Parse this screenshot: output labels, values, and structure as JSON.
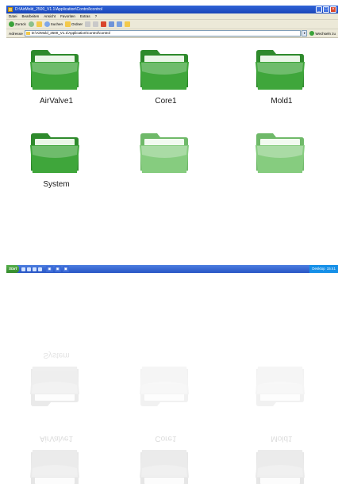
{
  "window": {
    "title": "D:\\AirMold_2500_V1.1\\Application\\Control\\control",
    "controls": [
      "_",
      "□",
      "×"
    ]
  },
  "menu": [
    "Datei",
    "Bearbeiten",
    "Ansicht",
    "Favoriten",
    "Extras",
    "?"
  ],
  "toolbar": {
    "back_label": "Zurück",
    "search_label": "Suchen",
    "folders_label": "Ordner"
  },
  "address": {
    "label": "Adresse",
    "value": "D:\\AirMold_2500_V1.1\\Application\\Control\\control",
    "go_label": "Wechseln zu"
  },
  "folders": [
    {
      "name": "AirValve1",
      "icon": "folder-icon"
    },
    {
      "name": "Core1",
      "icon": "folder-icon"
    },
    {
      "name": "Mold1",
      "icon": "folder-icon"
    },
    {
      "name": "System",
      "icon": "folder-icon"
    },
    {
      "name": "",
      "icon": "folder-icon"
    },
    {
      "name": "",
      "icon": "folder-icon"
    }
  ],
  "taskbar": {
    "start_label": "Start",
    "tray_label": "Desktop",
    "clock": "15:41"
  },
  "colors": {
    "folder_front": "#3fa63b",
    "folder_back": "#2e8a2c",
    "folder_light_front": "#86cc7f",
    "folder_light_back": "#6fb969",
    "titlebar": "#2f63d6",
    "taskbar": "#2855c5"
  }
}
